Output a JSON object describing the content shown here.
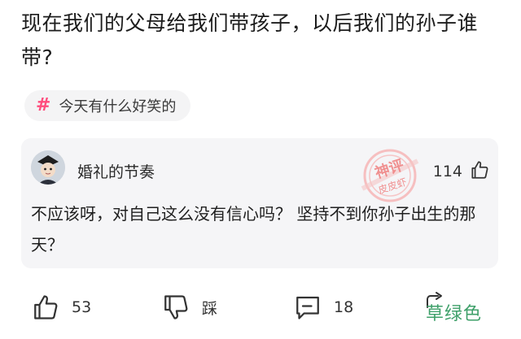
{
  "post": {
    "title": "现在我们的父母给我们带孩子，以后我们的孙子谁带?"
  },
  "topic": {
    "hash": "#",
    "label": "今天有什么好笑的"
  },
  "comment": {
    "username": "婚礼的节奏",
    "likes": "114",
    "body": "不应该呀，对自己这么没有信心吗？ 坚持不到你孙子出生的那天？",
    "stamp_line1": "神评",
    "stamp_line2": "皮皮虾"
  },
  "actions": {
    "like_count": "53",
    "dislike_label": "踩",
    "comment_count": "18"
  },
  "watermark": "草绿色",
  "colors": {
    "accent_pink": "#ff4d7d",
    "stamp_red": "#f04e4e",
    "watermark_green": "#3fa06a",
    "card_bg": "#f5f5f7"
  }
}
